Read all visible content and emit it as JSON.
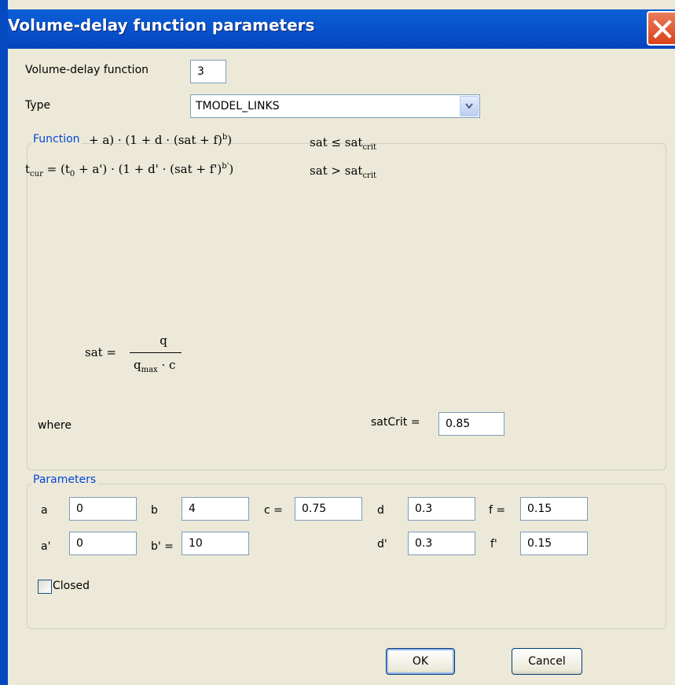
{
  "window": {
    "title": "Volume-delay function parameters"
  },
  "vdf": {
    "label": "Volume-delay function",
    "value": "3"
  },
  "type": {
    "label": "Type",
    "value": "TMODEL_LINKS"
  },
  "function_group": {
    "title": "Function",
    "formula1_lhs_visible": "+ a) · (1 + d · (sat + f)",
    "formula1_exp": "b",
    "formula1_cond": "sat ≤ sat",
    "formula1_cond_sub": "crit",
    "formula2_lhs": "t",
    "formula2_lhs_sub": "cur",
    "formula2_rhs_a": "= (t",
    "formula2_rhs_a_sub": "0",
    "formula2_rhs_b": "+ a') · (1 + d' · (sat + f')",
    "formula2_exp": "b'",
    "formula2_cond": "sat > sat",
    "formula2_cond_sub": "crit",
    "sat_lhs": "sat =",
    "sat_num": "q",
    "sat_den": "q",
    "sat_den_sub": "max",
    "sat_den_rest": "· c",
    "where_label": "where",
    "satcrit_label": "satCrit =",
    "satcrit_value": "0.85"
  },
  "parameters_group": {
    "title": "Parameters",
    "a_label": "a",
    "a_value": "0",
    "b_label": "b",
    "b_value": "4",
    "c_label": "c =",
    "c_value": "0.75",
    "d_label": "d",
    "d_value": "0.3",
    "f_label": "f =",
    "f_value": "0.15",
    "a2_label": "a'",
    "a2_value": "0",
    "b2_label": "b' =",
    "b2_value": "10",
    "d2_label": "d'",
    "d2_value": "0.3",
    "f2_label": "f'",
    "f2_value": "0.15",
    "closed_label": "Closed",
    "closed_checked": false
  },
  "buttons": {
    "ok": "OK",
    "cancel": "Cancel"
  }
}
